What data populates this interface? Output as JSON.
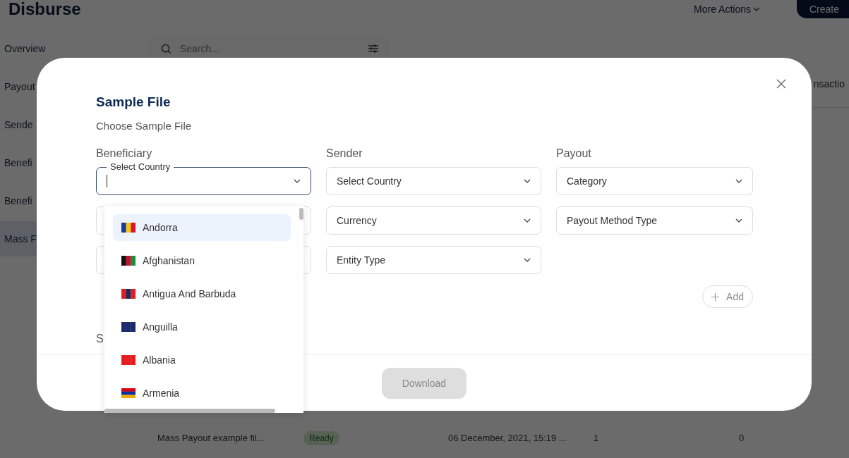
{
  "app": {
    "title": "Disburse",
    "more_actions": "More Actions",
    "create_button": "Create"
  },
  "sidebar": {
    "items": [
      {
        "label": "Overview",
        "selected": false
      },
      {
        "label": "Payout",
        "selected": false
      },
      {
        "label": "Sende",
        "selected": false
      },
      {
        "label": "Benefi",
        "selected": false
      },
      {
        "label": "Benefi",
        "selected": false
      },
      {
        "label": "Mass F",
        "selected": true
      }
    ]
  },
  "search": {
    "placeholder": "Search..."
  },
  "table": {
    "columns": [
      "nsactio"
    ],
    "rows": [
      {
        "name": "Mass Payout example fil...",
        "status": "Ready",
        "date": "06 December, 2021, 15:19 ...",
        "column_4": "1",
        "column_5": "0"
      }
    ]
  },
  "modal": {
    "title": "Sample File",
    "subtitle": "Choose Sample File",
    "groups": [
      {
        "heading": "Beneficiary",
        "fields": [
          {
            "label": "Select Country",
            "focused": true
          },
          {
            "focused": false
          },
          {
            "focused": false
          }
        ]
      },
      {
        "heading": "Sender",
        "fields": [
          {
            "label": "Select Country",
            "focused": false
          },
          {
            "label": "Currency",
            "focused": false
          },
          {
            "label": "Entity Type",
            "focused": false
          }
        ]
      },
      {
        "heading": "Payout",
        "fields": [
          {
            "label": "Category",
            "focused": false
          },
          {
            "label": "Payout Method Type",
            "focused": false
          }
        ]
      }
    ],
    "add_button": "Add",
    "section_heading": "S",
    "download_button": {
      "label": "Download",
      "disabled": true
    }
  },
  "dropdown": {
    "options": [
      {
        "label": "Andorra",
        "selected": true
      },
      {
        "label": "Afghanistan",
        "selected": false
      },
      {
        "label": "Antigua And Barbuda",
        "selected": false
      },
      {
        "label": "Anguilla",
        "selected": false
      },
      {
        "label": "Albania",
        "selected": false
      },
      {
        "label": "Armenia",
        "selected": false
      }
    ]
  }
}
